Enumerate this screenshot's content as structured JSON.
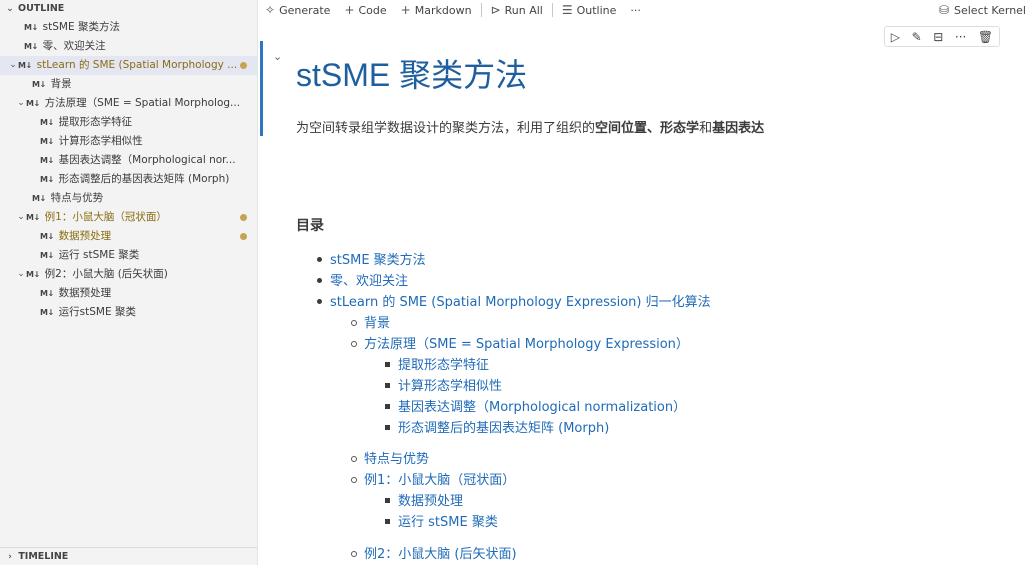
{
  "sidebar": {
    "header": "OUTLINE",
    "items": [
      {
        "label": "stSME 聚类方法",
        "selected": false,
        "modified": false,
        "dot": false
      },
      {
        "label": "零、欢迎关注",
        "selected": false,
        "modified": false,
        "dot": false
      },
      {
        "label": "stLearn 的 SME (Spatial Morphology ...",
        "selected": true,
        "modified": true,
        "dot": true
      },
      {
        "label": "背景",
        "selected": false,
        "modified": false,
        "dot": false
      },
      {
        "label": "方法原理（SME = Spatial Morpholog...",
        "selected": false,
        "modified": false,
        "dot": false
      },
      {
        "label": "提取形态学特征",
        "selected": false,
        "modified": false,
        "dot": false
      },
      {
        "label": "计算形态学相似性",
        "selected": false,
        "modified": false,
        "dot": false
      },
      {
        "label": "基因表达调整（Morphological nor...",
        "selected": false,
        "modified": false,
        "dot": false
      },
      {
        "label": "形态调整后的基因表达矩阵 (Morph)",
        "selected": false,
        "modified": false,
        "dot": false
      },
      {
        "label": "特点与优势",
        "selected": false,
        "modified": false,
        "dot": false
      },
      {
        "label": "例1：小鼠大脑（冠状面）",
        "selected": false,
        "modified": true,
        "dot": true
      },
      {
        "label": "数据预处理",
        "selected": false,
        "modified": true,
        "dot": true
      },
      {
        "label": "运行 stSME 聚类",
        "selected": false,
        "modified": false,
        "dot": false
      },
      {
        "label": "例2：小鼠大脑 (后矢状面)",
        "selected": false,
        "modified": false,
        "dot": false
      },
      {
        "label": "数据预处理",
        "selected": false,
        "modified": false,
        "dot": false
      },
      {
        "label": "运行stSME 聚类",
        "selected": false,
        "modified": false,
        "dot": false
      }
    ],
    "md_icon": "M↓",
    "timeline": "TIMELINE"
  },
  "toolbar": {
    "generate": "Generate",
    "code": "Code",
    "markdown": "Markdown",
    "run_all": "Run All",
    "outline": "Outline",
    "more": "···",
    "kernel": "Select Kernel"
  },
  "cell": {
    "title": "stSME 聚类方法",
    "desc_plain1": "为空间转录组学数据设计的聚类方法，利用了组织的",
    "desc_bold1": "空间位置",
    "desc_sep1": "、",
    "desc_bold2": "形态学",
    "desc_sep2": "和",
    "desc_bold3": "基因表达",
    "toc_heading": "目录"
  },
  "toc": [
    {
      "level": 1,
      "text": "stSME 聚类方法"
    },
    {
      "level": 1,
      "text": "零、欢迎关注"
    },
    {
      "level": 1,
      "text": "stLearn 的 SME (Spatial Morphology Expression) 归一化算法"
    },
    {
      "level": 2,
      "text": "背景"
    },
    {
      "level": 2,
      "text": "方法原理（SME = Spatial Morphology Expression）"
    },
    {
      "level": 3,
      "text": "提取形态学特征"
    },
    {
      "level": 3,
      "text": "计算形态学相似性"
    },
    {
      "level": 3,
      "text": "基因表达调整（Morphological normalization）"
    },
    {
      "level": 3,
      "text": "形态调整后的基因表达矩阵 (Morph)"
    },
    {
      "level": 2,
      "text": "特点与优势"
    },
    {
      "level": 2,
      "text": "例1：小鼠大脑（冠状面）"
    },
    {
      "level": 3,
      "text": "数据预处理"
    },
    {
      "level": 3,
      "text": "运行 stSME 聚类"
    },
    {
      "level": 2,
      "text": "例2：小鼠大脑 (后矢状面)"
    }
  ],
  "colors": {
    "accent": "#2d76c2",
    "title": "#1f5f9e",
    "link": "#1f6bb8",
    "modified_dot": "#c5a350"
  }
}
